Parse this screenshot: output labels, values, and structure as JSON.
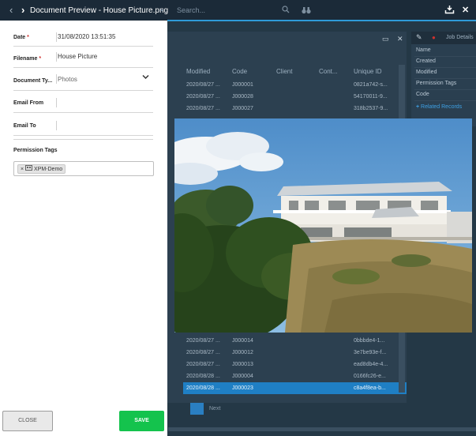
{
  "header": {
    "title": "Document Preview - House Picture.png",
    "search_placeholder": "Search..."
  },
  "form": {
    "date": {
      "label": "Date",
      "required": "*",
      "value": "31/08/2020 13:51:35"
    },
    "filename": {
      "label": "Filename",
      "required": "*",
      "value": "House Picture"
    },
    "document_type": {
      "label": "Document Ty...",
      "value": "Photos"
    },
    "email_from": {
      "label": "Email From",
      "value": ""
    },
    "email_to": {
      "label": "Email To",
      "value": ""
    },
    "permission_tags": {
      "label": "Permission Tags",
      "tags": [
        "XPM-Demo"
      ]
    },
    "close_label": "CLOSE",
    "save_label": "SAVE"
  },
  "background": {
    "columns": [
      "Modified",
      "Code",
      "Client",
      "Cont...",
      "Unique ID"
    ],
    "rows": [
      [
        "2020/08/27 ...",
        "J000001",
        "",
        "",
        "0821a742-s..."
      ],
      [
        "2020/08/27 ...",
        "J000028",
        "",
        "",
        "54170011-9..."
      ],
      [
        "2020/08/27 ...",
        "J000027",
        "",
        "",
        "318b2537-9..."
      ],
      [
        "2020/08/27 ...",
        "J000014",
        "",
        "",
        "0bbbde4-1..."
      ],
      [
        "2020/08/27 ...",
        "J000012",
        "",
        "",
        "3e7be93e-f..."
      ],
      [
        "2020/08/27 ...",
        "J000013",
        "",
        "",
        "ead8db4e-4..."
      ],
      [
        "2020/08/28 ...",
        "J000004",
        "",
        "",
        "0166fc26-e..."
      ],
      [
        "2020/08/28 ...",
        "J000023",
        "",
        "",
        "c8a4f8ea-b..."
      ]
    ],
    "right_panel": {
      "header": "Job Details",
      "items": [
        "Name",
        "Created",
        "Modified",
        "Permission Tags",
        "Code"
      ],
      "link": "Related Records"
    },
    "pager": {
      "next": "Next"
    }
  }
}
